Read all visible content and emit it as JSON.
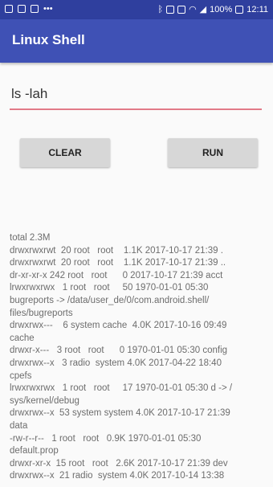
{
  "statusbar": {
    "time": "12:11",
    "battery": "100%",
    "left_icons": [
      "image-icon",
      "mail-icon",
      "chat-icon",
      "more-icon"
    ],
    "right_icons": [
      "bluetooth-icon",
      "vibrate-icon",
      "nfc-icon",
      "wifi-icon",
      "signal-icon",
      "battery-icon"
    ]
  },
  "appbar": {
    "title": "Linux Shell",
    "color": "#3f51b5"
  },
  "command": {
    "value": "ls -lah"
  },
  "buttons": {
    "clear_label": "CLEAR",
    "run_label": "RUN"
  },
  "output": {
    "lines": [
      "total 2.3M",
      "drwxrwxrwt  20 root   root    1.1K 2017-10-17 21:39 .",
      "drwxrwxrwt  20 root   root    1.1K 2017-10-17 21:39 ..",
      "dr-xr-xr-x 242 root   root      0 2017-10-17 21:39 acct",
      "lrwxrwxrwx   1 root   root     50 1970-01-01 05:30",
      "bugreports -> /data/user_de/0/com.android.shell/",
      "files/bugreports",
      "drwxrwx---    6 system cache  4.0K 2017-10-16 09:49",
      "cache",
      "drwxr-x---   3 root   root      0 1970-01-01 05:30 config",
      "drwxrwx--x   3 radio  system 4.0K 2017-04-22 18:40",
      "cpefs",
      "lrwxrwxrwx   1 root   root     17 1970-01-01 05:30 d -> /",
      "sys/kernel/debug",
      "drwxrwx--x  53 system system 4.0K 2017-10-17 21:39",
      "data",
      "-rw-r--r--   1 root   root   0.9K 1970-01-01 05:30",
      "default.prop",
      "drwxr-xr-x  15 root   root   2.6K 2017-10-17 21:39 dev",
      "drwxrwx--x  21 radio  system 4.0K 2017-10-14 13:38"
    ]
  }
}
